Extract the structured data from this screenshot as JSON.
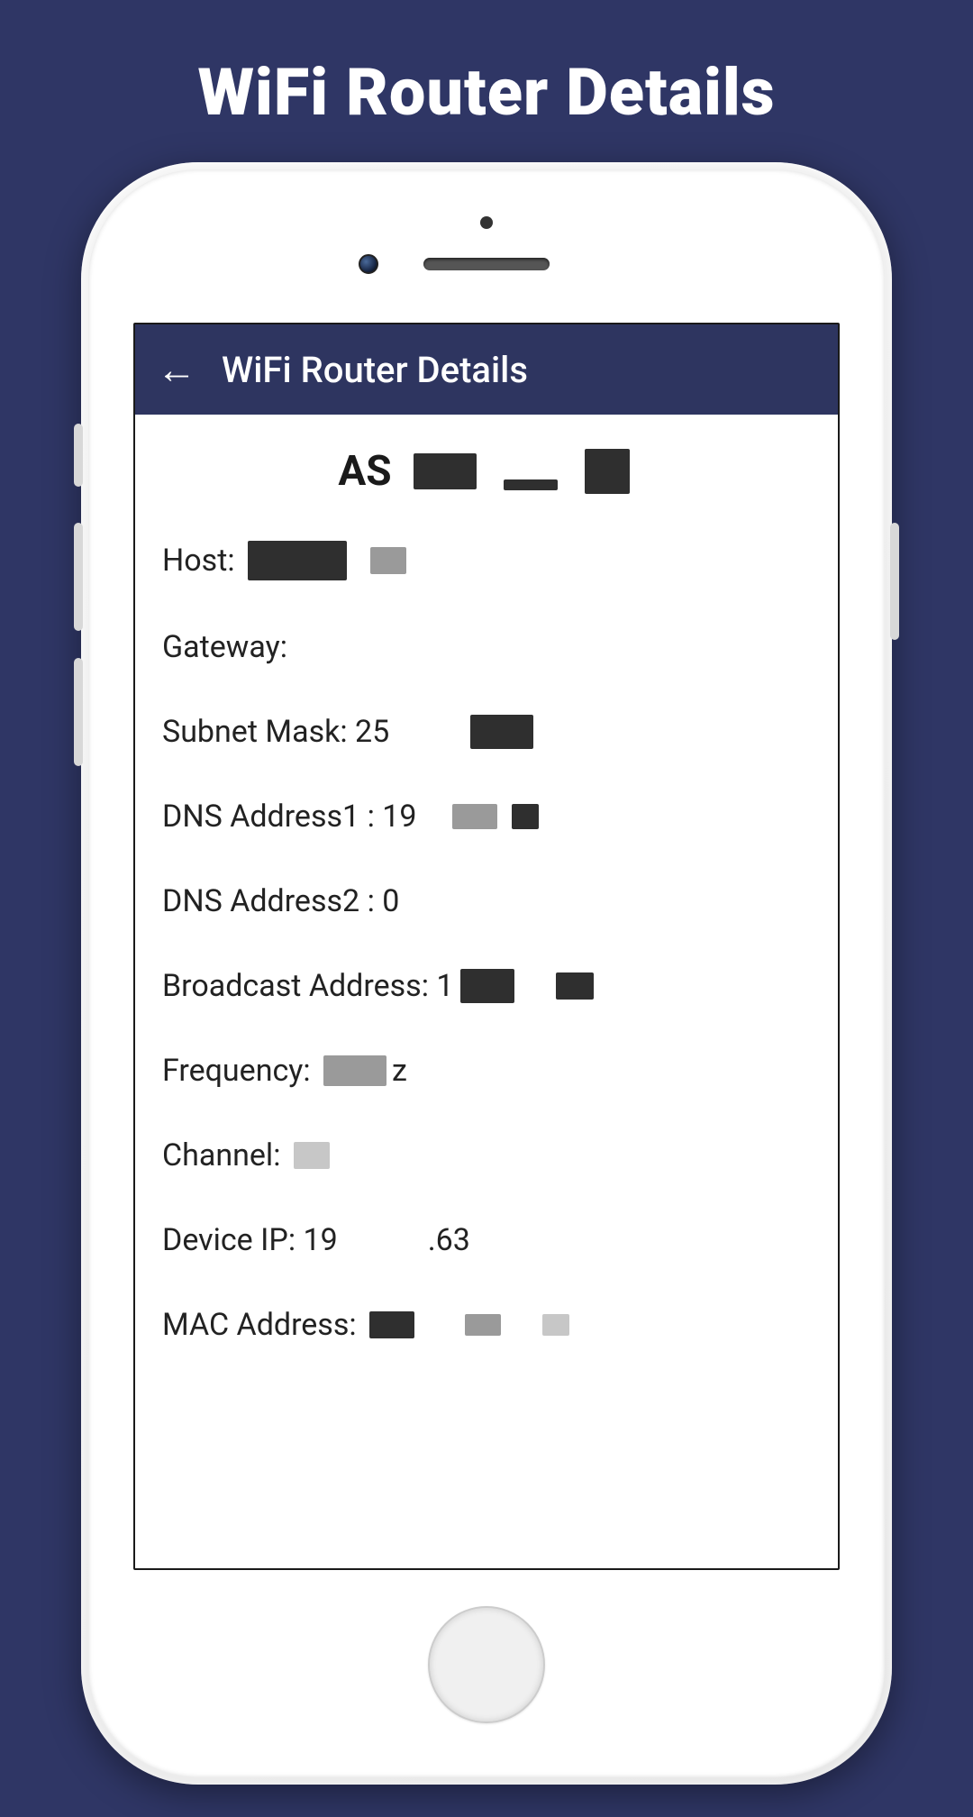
{
  "promo_title": "WiFi Router Details",
  "header": {
    "title": "WiFi Router Details"
  },
  "network": {
    "name_prefix": "AS"
  },
  "rows": [
    {
      "label": "Host: "
    },
    {
      "label": "Gateway: "
    },
    {
      "label": "Subnet Mask: ",
      "partial": "25"
    },
    {
      "label": "DNS Address1 : ",
      "partial": "19"
    },
    {
      "label": "DNS Address2 : ",
      "partial": "0"
    },
    {
      "label": "Broadcast Address: ",
      "partial": "1"
    },
    {
      "label": "Frequency: ",
      "suffix": "z"
    },
    {
      "label": "Channel: "
    },
    {
      "label": "Device IP: ",
      "partial": "19",
      "suffix2": ".63"
    },
    {
      "label": "MAC Address: "
    }
  ]
}
